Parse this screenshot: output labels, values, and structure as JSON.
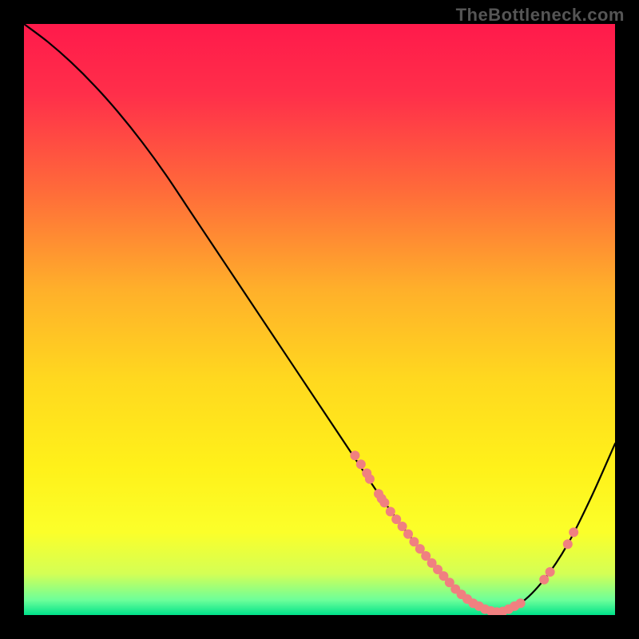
{
  "watermark": "TheBottleneck.com",
  "chart_data": {
    "type": "line",
    "title": "",
    "xlabel": "",
    "ylabel": "",
    "xlim": [
      0,
      100
    ],
    "ylim": [
      0,
      100
    ],
    "grid": false,
    "legend": false,
    "background": {
      "kind": "vertical-gradient",
      "stops": [
        {
          "offset": 0.0,
          "color": "#ff1a4b"
        },
        {
          "offset": 0.12,
          "color": "#ff2f4a"
        },
        {
          "offset": 0.28,
          "color": "#ff6a3a"
        },
        {
          "offset": 0.45,
          "color": "#ffb02a"
        },
        {
          "offset": 0.6,
          "color": "#ffd81f"
        },
        {
          "offset": 0.75,
          "color": "#fff11a"
        },
        {
          "offset": 0.86,
          "color": "#fbff2a"
        },
        {
          "offset": 0.93,
          "color": "#d4ff55"
        },
        {
          "offset": 0.975,
          "color": "#6cff9a"
        },
        {
          "offset": 1.0,
          "color": "#00e28a"
        }
      ]
    },
    "series": [
      {
        "name": "bottleneck-curve",
        "color": "#000000",
        "x": [
          0,
          4,
          8,
          12,
          16,
          20,
          24,
          28,
          32,
          36,
          40,
          44,
          48,
          52,
          56,
          60,
          64,
          68,
          72,
          74,
          76,
          78,
          80,
          84,
          88,
          92,
          96,
          100
        ],
        "y": [
          100,
          97,
          93.5,
          89.5,
          85,
          80,
          74.5,
          68.5,
          62.5,
          56.5,
          50.5,
          44.5,
          38.5,
          32.5,
          26.5,
          20.5,
          15,
          10,
          5.5,
          3.5,
          2,
          1,
          0.5,
          2,
          6,
          12,
          20,
          29
        ]
      }
    ],
    "points": {
      "name": "sample-dots",
      "color": "#f08080",
      "radius": 6,
      "data": [
        {
          "x": 56,
          "y": 27
        },
        {
          "x": 57,
          "y": 25.5
        },
        {
          "x": 58,
          "y": 24
        },
        {
          "x": 58.5,
          "y": 23
        },
        {
          "x": 60,
          "y": 20.5
        },
        {
          "x": 60.5,
          "y": 19.7
        },
        {
          "x": 61,
          "y": 19
        },
        {
          "x": 62,
          "y": 17.5
        },
        {
          "x": 63,
          "y": 16.2
        },
        {
          "x": 64,
          "y": 15
        },
        {
          "x": 65,
          "y": 13.7
        },
        {
          "x": 66,
          "y": 12.4
        },
        {
          "x": 67,
          "y": 11.2
        },
        {
          "x": 68,
          "y": 10
        },
        {
          "x": 69,
          "y": 8.8
        },
        {
          "x": 70,
          "y": 7.7
        },
        {
          "x": 71,
          "y": 6.6
        },
        {
          "x": 72,
          "y": 5.5
        },
        {
          "x": 73,
          "y": 4.4
        },
        {
          "x": 74,
          "y": 3.5
        },
        {
          "x": 75,
          "y": 2.7
        },
        {
          "x": 76,
          "y": 2
        },
        {
          "x": 77,
          "y": 1.5
        },
        {
          "x": 78,
          "y": 1
        },
        {
          "x": 79,
          "y": 0.7
        },
        {
          "x": 80,
          "y": 0.5
        },
        {
          "x": 81,
          "y": 0.6
        },
        {
          "x": 82,
          "y": 1
        },
        {
          "x": 83,
          "y": 1.5
        },
        {
          "x": 84,
          "y": 2
        },
        {
          "x": 88,
          "y": 6
        },
        {
          "x": 89,
          "y": 7.3
        },
        {
          "x": 92,
          "y": 12
        },
        {
          "x": 93,
          "y": 14
        }
      ]
    }
  }
}
